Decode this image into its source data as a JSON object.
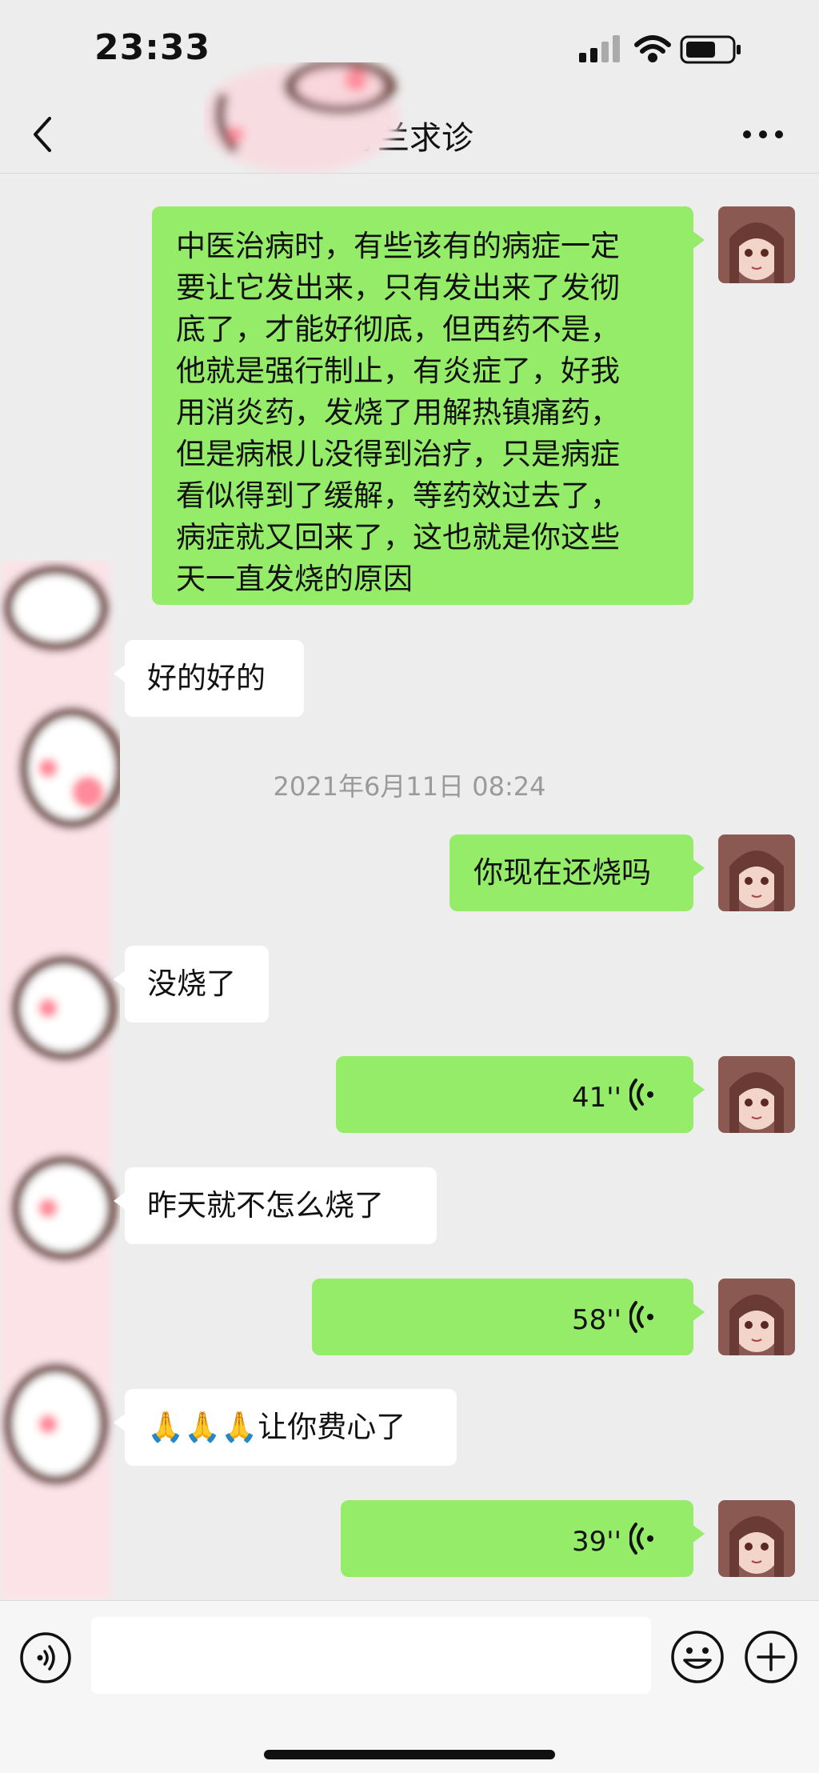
{
  "status": {
    "time": "23:33"
  },
  "header": {
    "title": "芬兰求诊"
  },
  "messages": {
    "m1": "中医治病时，有些该有的病症一定\n要让它发出来，只有发出来了发彻\n底了，才能好彻底，但西药不是，\n他就是强行制止，有炎症了，好我\n用消炎药，发烧了用解热镇痛药，\n但是病根儿没得到治疗，只是病症\n看似得到了缓解，等药效过去了，\n病症就又回来了，这也就是你这些\n天一直发烧的原因",
    "m2": "好的好的",
    "timestamp": "2021年6月11日 08:24",
    "m3": "你现在还烧吗",
    "m4": "没烧了",
    "m5": "41''",
    "m6": "昨天就不怎么烧了",
    "m7": "58''",
    "m8": "🙏🙏🙏让你费心了",
    "m9": "39''"
  },
  "colors": {
    "outgoing_bubble": "#95ec69",
    "incoming_bubble": "#ffffff",
    "background": "#ededed"
  },
  "icons": [
    "back-icon",
    "more-icon",
    "voice-icon",
    "emoji-icon",
    "plus-icon",
    "signal-icon",
    "wifi-icon",
    "battery-icon"
  ]
}
